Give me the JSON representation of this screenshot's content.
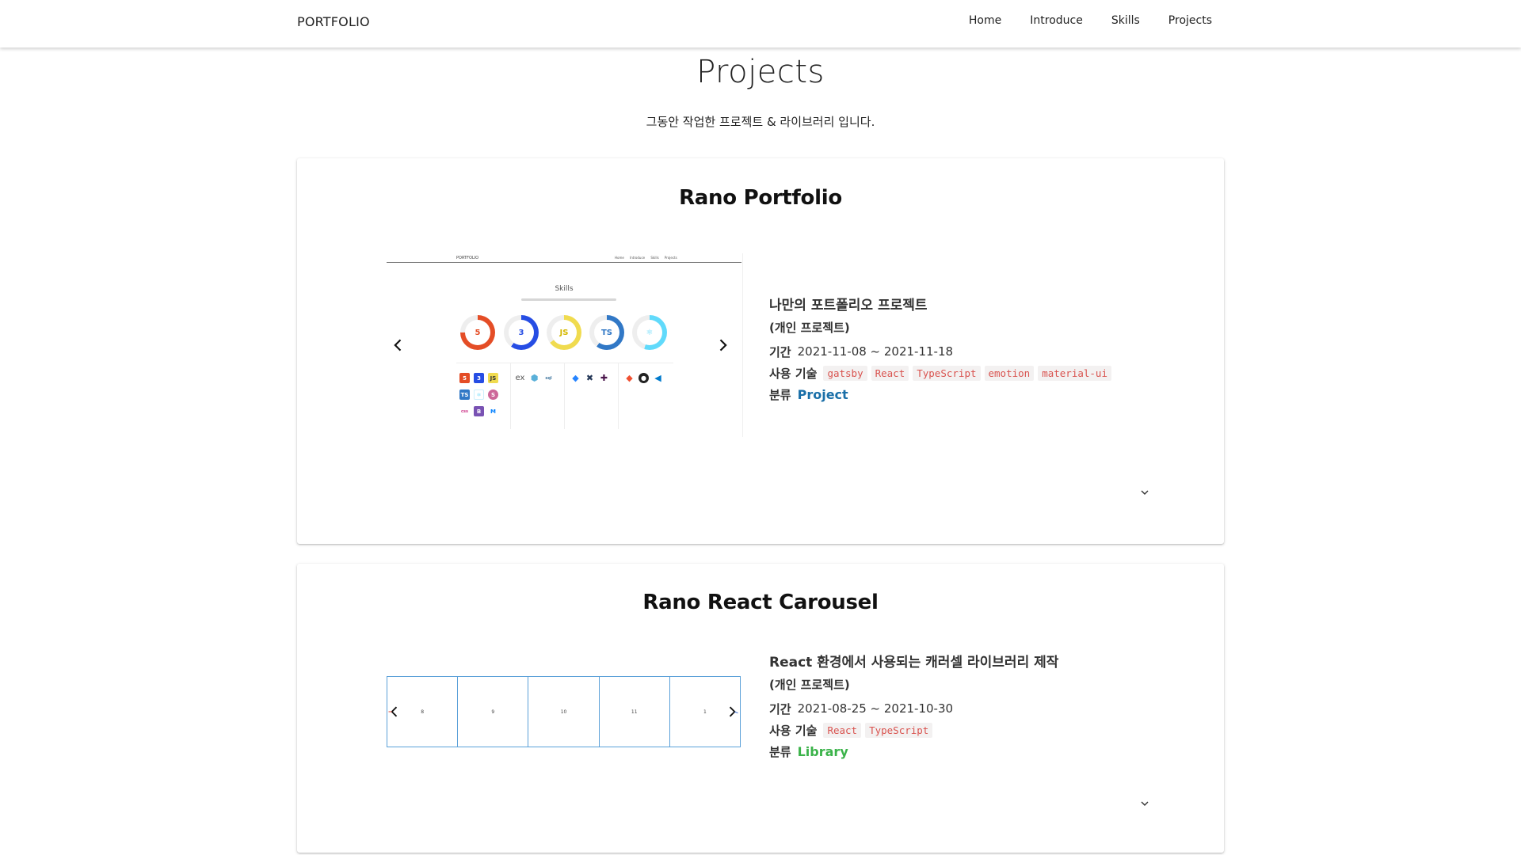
{
  "header": {
    "brand": "PORTFOLIO",
    "nav": [
      "Home",
      "Introduce",
      "Skills",
      "Projects"
    ]
  },
  "section": {
    "title": "Projects",
    "subtitle": "그동안 작업한 프로젝트 & 라이브러리 입니다."
  },
  "projects": [
    {
      "title": "Rano Portfolio",
      "description": "나만의 포트폴리오 프로젝트",
      "type": "(개인 프로젝트)",
      "period_label": "기간",
      "period": "2021-11-08 ~ 2021-11-18",
      "tech_label": "사용 기술",
      "tech": [
        "gatsby",
        "React",
        "TypeScript",
        "emotion",
        "material-ui"
      ],
      "category_label": "분류",
      "category": "Project",
      "category_color": "#1a6fa8",
      "preview": {
        "mini_brand": "PORTFOLIO",
        "mini_nav": "Home Introduce Skills Projects",
        "mini_title": "Skills",
        "rings": [
          {
            "label": "5",
            "color": "#e44d26",
            "pct": 0.75
          },
          {
            "label": "3",
            "color": "#264de4",
            "pct": 0.6
          },
          {
            "label": "JS",
            "color": "#f0db4f",
            "pct": 0.65
          },
          {
            "label": "TS",
            "color": "#3178c6",
            "pct": 0.6
          },
          {
            "label": "⚛",
            "color": "#61dafb",
            "pct": 0.55
          }
        ]
      }
    },
    {
      "title": "Rano React Carousel",
      "description": "React 환경에서 사용되는 캐러셀 라이브러리 제작",
      "type": "(개인 프로젝트)",
      "period_label": "기간",
      "period": "2021-08-25 ~ 2021-10-30",
      "tech_label": "사용 기술",
      "tech": [
        "React",
        "TypeScript"
      ],
      "category_label": "분류",
      "category": "Library",
      "category_color": "#3bb34a",
      "preview": {
        "slides": [
          "8",
          "9",
          "10",
          "11",
          "1"
        ]
      }
    }
  ],
  "icons": {
    "prev": "chevron-left-icon",
    "next": "chevron-right-icon",
    "expand": "chevron-down-icon"
  }
}
